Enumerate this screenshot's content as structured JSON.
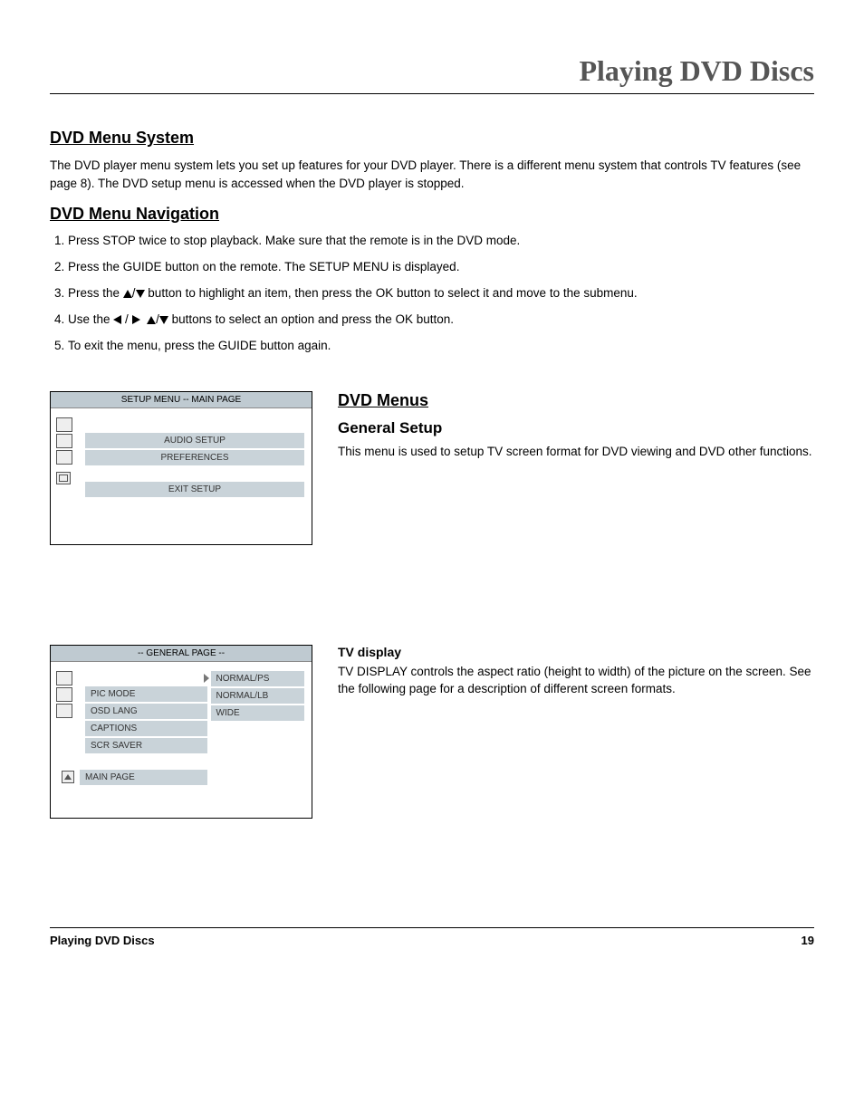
{
  "chapter_title": "Playing DVD Discs",
  "s1": {
    "heading": "DVD Menu System",
    "para": "The DVD player menu system lets you set up features for your DVD player. There is a different menu system that controls TV features (see page 8). The DVD setup menu is accessed when the DVD player is stopped."
  },
  "s2": {
    "heading": "DVD Menu Navigation",
    "step1": "Press STOP twice to stop playback. Make sure that the remote is in the DVD mode.",
    "step2": "Press the GUIDE button on the remote. The SETUP MENU is displayed.",
    "step3a": "Press the ",
    "step3b": " button to highlight an item, then press the OK button to select it and move to the submenu.",
    "step4a": "Use the ",
    "step4b": " buttons to select an option and press the OK button.",
    "step5": "To exit the menu, press the GUIDE button again."
  },
  "menu1": {
    "title": "SETUP MENU -- MAIN PAGE",
    "item_audio": "AUDIO SETUP",
    "item_prefs": "PREFERENCES",
    "item_exit": "EXIT SETUP"
  },
  "s3": {
    "heading": "DVD Menus",
    "sub": "General Setup",
    "para": "This menu is used to setup TV screen format for DVD viewing and DVD other functions."
  },
  "menu2": {
    "title": "-- GENERAL PAGE --",
    "colA": {
      "pic": "PIC MODE",
      "osd": "OSD LANG",
      "cap": "CAPTIONS",
      "scr": "SCR SAVER",
      "main": "MAIN PAGE"
    },
    "colB": {
      "ps": "NORMAL/PS",
      "lb": "NORMAL/LB",
      "wide": "WIDE"
    }
  },
  "s4": {
    "heading": "TV display",
    "para": "TV DISPLAY controls the aspect ratio (height to width) of the picture on the screen. See the following page for a description of different screen formats."
  },
  "footer": {
    "left": "Playing DVD Discs",
    "right": "19"
  }
}
